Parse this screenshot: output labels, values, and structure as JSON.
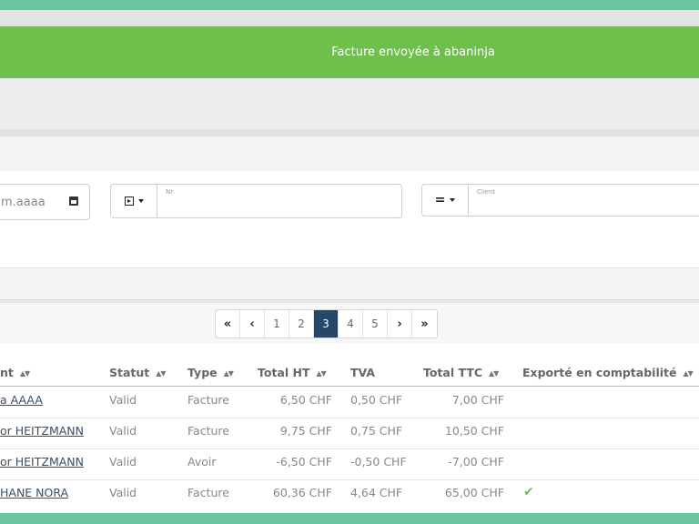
{
  "toast": {
    "message": "Facture envoyée à abaninja"
  },
  "filters": {
    "date_placeholder": "m.aaaa",
    "number": {
      "label": "Nr."
    },
    "client": {
      "operator": "=",
      "label": "Client"
    }
  },
  "pagination": {
    "first": "«",
    "prev": "‹",
    "pages": [
      "1",
      "2",
      "3",
      "4",
      "5"
    ],
    "active": "3",
    "next": "›",
    "last": "»"
  },
  "table": {
    "columns": [
      "nt",
      "Statut",
      "Type",
      "Total HT",
      "TVA",
      "Total TTC",
      "Exporté en comptabilité"
    ],
    "rows": [
      {
        "client": "a AAAA",
        "status": "Valid",
        "type": "Facture",
        "total_ht": "6,50 CHF",
        "tva": "0,50 CHF",
        "total_ttc": "7,00 CHF",
        "exported": ""
      },
      {
        "client": "or HEITZMANN",
        "status": "Valid",
        "type": "Facture",
        "total_ht": "9,75 CHF",
        "tva": "0,75 CHF",
        "total_ttc": "10,50 CHF",
        "exported": ""
      },
      {
        "client": "or HEITZMANN",
        "status": "Valid",
        "type": "Avoir",
        "total_ht": "-6,50 CHF",
        "tva": "-0,50 CHF",
        "total_ttc": "-7,00 CHF",
        "exported": ""
      },
      {
        "client": "HANE NORA",
        "status": "Valid",
        "type": "Facture",
        "total_ht": "60,36 CHF",
        "tva": "4,64 CHF",
        "total_ttc": "65,00 CHF",
        "exported": "✔"
      }
    ]
  },
  "colors": {
    "toast": "#6dc04a",
    "accent_teal": "#6cc5a1",
    "active_page": "#26476a"
  }
}
